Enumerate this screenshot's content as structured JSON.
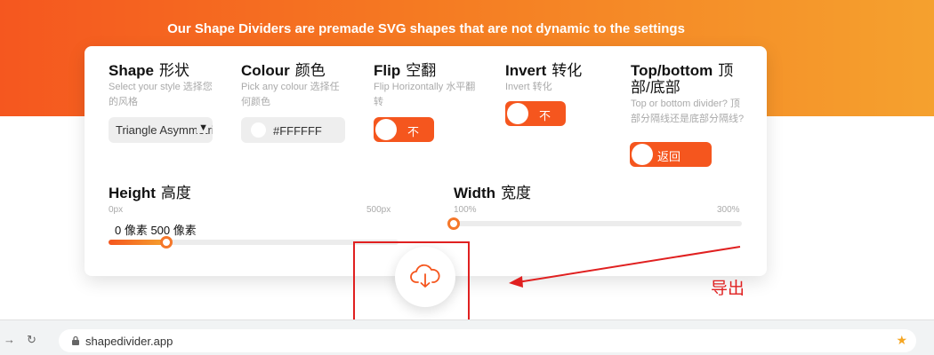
{
  "hero": {
    "text": "Our Shape Dividers are premade SVG shapes that are not dynamic to the settings"
  },
  "controls": {
    "shape": {
      "title": "Shape",
      "title_zh": "形状",
      "subtitle": "Select your style",
      "subtitle_zh": "选择您的风格",
      "value": "Triangle Asymmetrical"
    },
    "colour": {
      "title": "Colour",
      "title_zh": "颜色",
      "subtitle": "Pick any colour",
      "subtitle_zh": "选择任何颜色",
      "value": "#FFFFFF"
    },
    "flip": {
      "title": "Flip",
      "title_zh": "空翻",
      "subtitle": "Flip Horizontally",
      "subtitle_zh": "水平翻转",
      "toggle_label": "不"
    },
    "invert": {
      "title": "Invert",
      "title_zh": "转化",
      "subtitle": "Invert",
      "subtitle_zh": "转化",
      "toggle_label": "不"
    },
    "top_bottom": {
      "title": "Top/bottom",
      "title_zh": "顶部/底部",
      "subtitle": "Top or bottom divider?",
      "subtitle_zh": "顶部分隔线还是底部分隔线?",
      "toggle_label": "返回"
    },
    "height": {
      "title": "Height",
      "title_zh": "高度",
      "min_label": "0px",
      "max_label": "500px",
      "tooltip": "0 像素 500 像素",
      "value_fraction": 0.2
    },
    "width": {
      "title": "Width",
      "title_zh": "宽度",
      "min_label": "100%",
      "max_label": "300%",
      "value_fraction": 0.0
    }
  },
  "download": {
    "icon": "cloud-download-icon"
  },
  "annotation": {
    "text": "导出",
    "color": "#e02020"
  },
  "browser": {
    "url": "shapedivider.app",
    "back_icon": "arrow-right-icon",
    "reload_icon": "reload-icon",
    "lock_icon": "lock-icon",
    "star_icon": "star-icon"
  },
  "colors": {
    "accent": "#f5561e",
    "accent_end": "#f5a12e"
  }
}
